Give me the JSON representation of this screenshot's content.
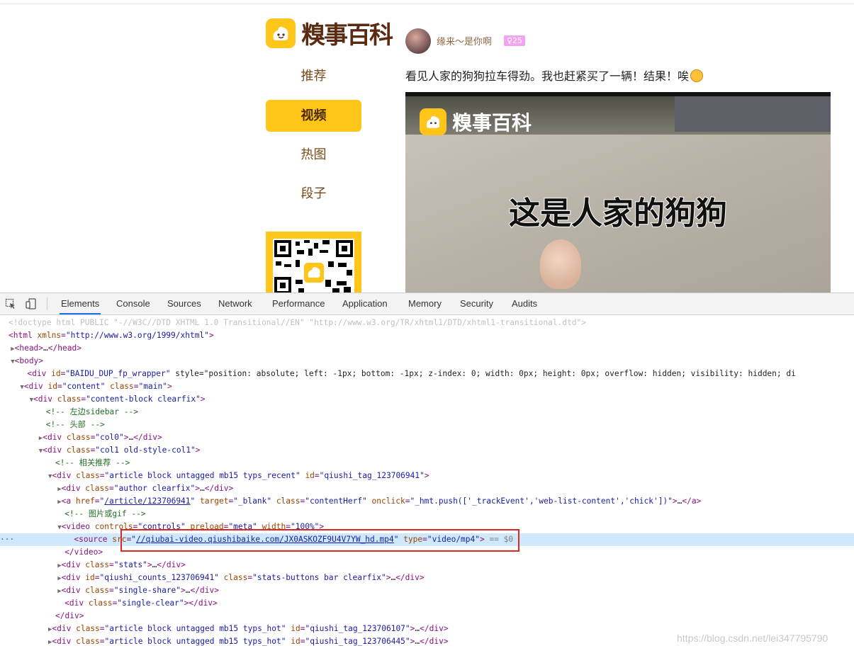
{
  "site": {
    "logo_text": "糗事百科",
    "nav": [
      {
        "label": "推荐",
        "active": false
      },
      {
        "label": "视频",
        "active": true
      },
      {
        "label": "热图",
        "active": false
      },
      {
        "label": "段子",
        "active": false
      }
    ]
  },
  "post": {
    "author_name": "缘来～是你啊",
    "author_age": "♀25",
    "text": "看见人家的狗狗拉车得劲。我也赶紧买了一辆！结果！唉",
    "video": {
      "logo_text": "糗事百科",
      "caption": "这是人家的狗狗"
    }
  },
  "devtools": {
    "tabs": [
      "Elements",
      "Console",
      "Sources",
      "Network",
      "Performance",
      "Application",
      "Memory",
      "Security",
      "Audits"
    ],
    "active_tab": "Elements",
    "lines": [
      "<!doctype html PUBLIC \"-//W3C//DTD XHTML 1.0 Transitional//EN\" \"http://www.w3.org/TR/xhtml1/DTD/xhtml1-transitional.dtd\">",
      "<html xmlns=\"http://www.w3.org/1999/xhtml\">",
      "<head>…</head>",
      "<body>",
      "<div id=\"BAIDU_DUP_fp_wrapper\" style=\"position: absolute; left: -1px; bottom: -1px; z-index: 0; width: 0px; height: 0px; overflow: hidden; visibility: hidden; di",
      "<div id=\"content\" class=\"main\">",
      "<div class=\"content-block clearfix\">",
      "<!-- 左边sidebar -->",
      "<!-- 头部 -->",
      "<div class=\"col0\">…</div>",
      "<div class=\"col1 old-style-col1\">",
      "<!-- 相关推荐 -->",
      "<div class=\"article block untagged mb15 typs_recent\" id=\"qiushi_tag_123706941\">",
      "<div class=\"author clearfix\">…</div>",
      "<a href=\"/article/123706941\" target=\"_blank\" class=\"contentHerf\" onclick=\"_hmt.push(['_trackEvent','web-list-content','chick'])\">…</a>",
      "<!-- 图片或gif -->",
      "<video controls=\"controls\" preload=\"meta\" width=\"100%\">",
      "<source src=\"//qiubai-video.qiushibaike.com/JX0ASKOZF9U4V7YW_hd.mp4\" type=\"video/mp4\"> == $0",
      "</video>",
      "<div class=\"stats\">…</div>",
      "<div id=\"qiushi_counts_123706941\" class=\"stats-buttons bar clearfix\">…</div>",
      "<div class=\"single-share\">…</div>",
      "<div class=\"single-clear\"></div>",
      "</div>",
      "<div class=\"article block untagged mb15 typs_hot\" id=\"qiushi_tag_123706107\">…</div>",
      "<div class=\"article block untagged mb15 typs_hot\" id=\"qiushi_tag_123706445\">…</div>"
    ],
    "selected_line": 17
  },
  "watermark": "https://blog.csdn.net/lei347795790"
}
